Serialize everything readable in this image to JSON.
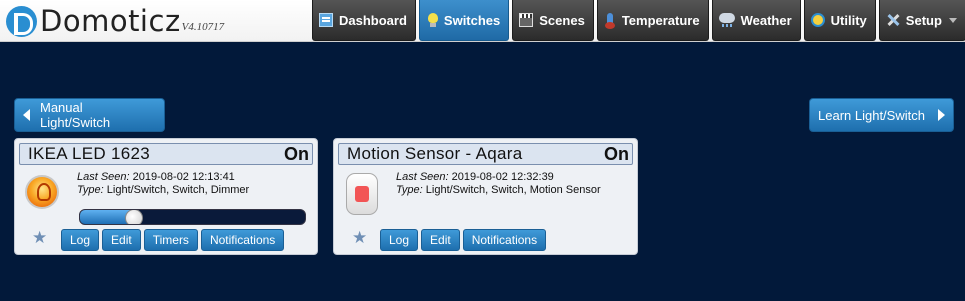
{
  "header": {
    "app_name": "Domoticz",
    "version": "V4.10717",
    "nav": [
      {
        "label": "Dashboard",
        "icon": "dashboard-icon",
        "active": false
      },
      {
        "label": "Switches",
        "icon": "lightbulb-icon",
        "active": true
      },
      {
        "label": "Scenes",
        "icon": "clapperboard-icon",
        "active": false
      },
      {
        "label": "Temperature",
        "icon": "thermometer-icon",
        "active": false
      },
      {
        "label": "Weather",
        "icon": "cloud-rain-icon",
        "active": false
      },
      {
        "label": "Utility",
        "icon": "utility-icon",
        "active": false
      },
      {
        "label": "Setup",
        "icon": "tools-icon",
        "active": false
      }
    ]
  },
  "actions": {
    "manual_label": "Manual Light/Switch",
    "learn_label": "Learn Light/Switch"
  },
  "devices": [
    {
      "name": "IKEA LED 1623",
      "status": "On",
      "icon": "lightbulb-icon",
      "last_seen_label": "Last Seen:",
      "last_seen": "2019-08-02 12:13:41",
      "type_label": "Type:",
      "type": "Light/Switch, Switch, Dimmer",
      "dimmer_level": 0.24,
      "buttons": [
        "Log",
        "Edit",
        "Timers",
        "Notifications"
      ]
    },
    {
      "name": "Motion Sensor - Aqara",
      "status": "On",
      "icon": "motion-sensor-icon",
      "last_seen_label": "Last Seen:",
      "last_seen": "2019-08-02 12:32:39",
      "type_label": "Type:",
      "type": "Light/Switch, Switch, Motion Sensor",
      "buttons": [
        "Log",
        "Edit",
        "Notifications"
      ]
    }
  ],
  "colors": {
    "background": "#02193a",
    "accent": "#2a7fc0",
    "active_tab": "#2f80c0"
  }
}
